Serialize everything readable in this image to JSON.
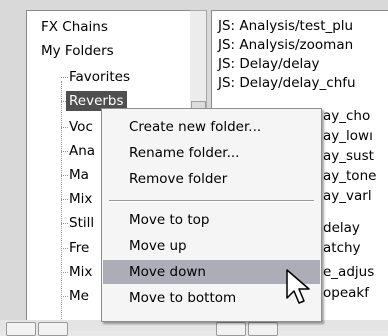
{
  "tree": {
    "roots": [
      "FX Chains",
      "My Folders"
    ],
    "children": [
      "Favorites",
      "Reverbs",
      "Voc",
      "Ana",
      "Ma",
      "Mix",
      "Still",
      "Fre",
      "Mix",
      "Me"
    ],
    "selected_index": 1
  },
  "list": {
    "items": [
      "JS: Analysis/test_plu",
      "JS: Analysis/zooman",
      "JS: Delay/delay",
      "JS: Delay/delay_chfu",
      "ay_cho",
      "ay_lowı",
      "ay_sust",
      "ay_tone",
      "ay_varl",
      "delay",
      "atchy",
      "e_adjus",
      "opeakf"
    ]
  },
  "menu": {
    "items": [
      "Create new folder...",
      "Rename folder...",
      "Remove folder",
      "Move to top",
      "Move up",
      "Move down",
      "Move to bottom"
    ],
    "highlighted_index": 5
  },
  "icons": {
    "cursor": "mouse-pointer-icon"
  }
}
